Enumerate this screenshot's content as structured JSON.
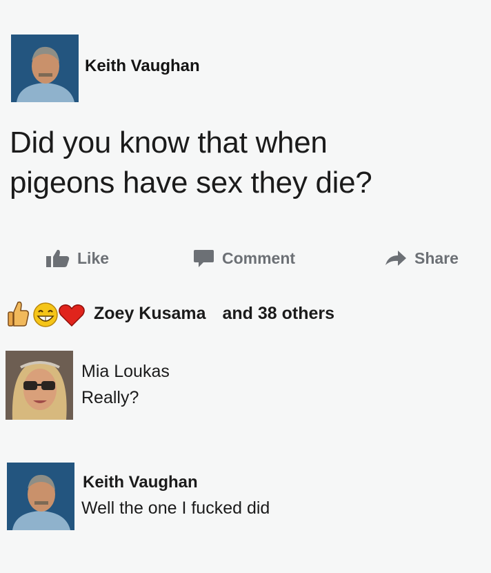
{
  "post": {
    "author": "Keith Vaughan",
    "text_line1": "Did you know that when",
    "text_line2": "pigeons have sex they die?"
  },
  "actions": {
    "like": "Like",
    "comment": "Comment",
    "share": "Share"
  },
  "reactions": {
    "icons": [
      "thumbs-up-icon",
      "grin-emoji-icon",
      "heart-icon"
    ],
    "name": "Zoey Kusama",
    "others": "and 38 others"
  },
  "comments": [
    {
      "author": "Mia Loukas",
      "text": "Really?"
    },
    {
      "author": "Keith Vaughan",
      "text": "Well the one I fucked did"
    }
  ],
  "colors": {
    "background": "#f6f7f7",
    "action_gray": "#6c7075",
    "heart": "#e0241c",
    "emoji": "#f5c518"
  }
}
